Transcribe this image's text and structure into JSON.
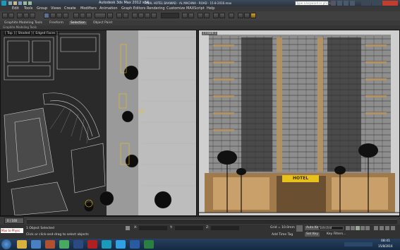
{
  "titlebar": {
    "app_name": "Autodesk 3ds Max 2012 x64",
    "file_name": "FINAL   HOTEL   BAAWAD   -   AL MACHNA - ROAD   -   15-8-2016.max",
    "search_placeholder": "Type a keyword or phrase"
  },
  "menubar": {
    "items": [
      "Edit",
      "Tools",
      "Group",
      "Views",
      "Create",
      "Modifiers",
      "Animation",
      "Graph Editors",
      "Rendering",
      "Customize",
      "MAXScript",
      "Help"
    ]
  },
  "ribbon": {
    "tabs": [
      "Graphite Modeling Tools",
      "Freeform",
      "Selection",
      "Object Paint"
    ],
    "selected_tab": "Selection",
    "row_label": "Graphite Modeling Tools"
  },
  "viewports": {
    "left_label": "[ Top ] [ Shaded ] [ Edged Faces ]",
    "right_label": "[ Front ]",
    "hotel_sign": "HOTEL"
  },
  "timeline": {
    "frame": "0 / 100",
    "ticks": [
      "0",
      "10",
      "20",
      "30",
      "40",
      "50",
      "60",
      "70",
      "80",
      "90",
      "100"
    ]
  },
  "statusbar": {
    "script_input": "Max to Physc",
    "selection_status": "1 Object Selected",
    "prompt": "Click or click-and-drag to select objects",
    "grid": "Grid = 10.0mm",
    "auto_key": "Auto Key",
    "set_key": "Set Key",
    "selected_dropdown": "Selected",
    "key_filters": "Key Filters...",
    "add_time_tag": "Add Time Tag",
    "x_label": "X:",
    "y_label": "Y:",
    "z_label": "Z:"
  },
  "taskbar": {
    "time": "08:41",
    "date": "15/8/2016"
  },
  "colors": {
    "titlebar": "#2a3440",
    "viewport_left_bg": "#1b1b1b",
    "viewport_right_bg": "#d8d8d8",
    "accent_yellow": "#e8c21a",
    "facade_gold": "#b89560",
    "taskbar": "#1d3553"
  },
  "icons": {
    "app": "3ds-max-logo-icon",
    "search": "search-icon",
    "close": "close-icon",
    "minimize": "minimize-icon",
    "maximize": "maximize-icon",
    "play": "play-icon",
    "start": "windows-start-icon"
  }
}
